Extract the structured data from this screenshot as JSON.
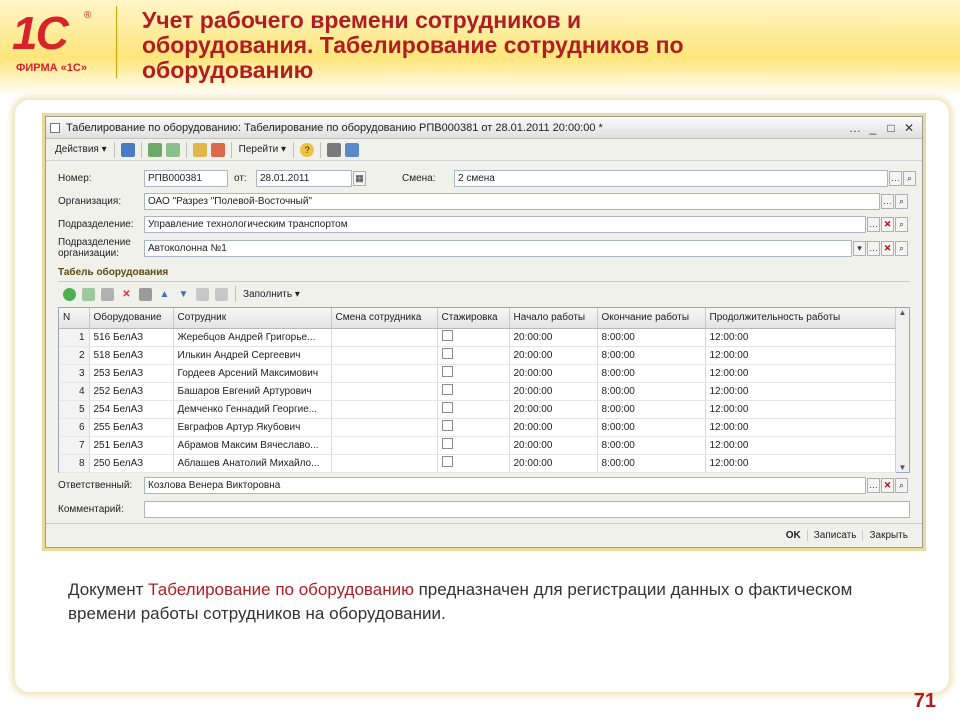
{
  "slide": {
    "logo_text": "1С",
    "logo_reg": "®",
    "logo_firm": "ФИРМА «1С»",
    "title": "Учет рабочего времени сотрудников и оборудования. Табелирование сотрудников по оборудованию",
    "desc_prefix": "Документ ",
    "desc_highlight": "Табелирование по оборудованию",
    "desc_suffix": " предназначен для регистрации данных о фактическом времени работы сотрудников на оборудовании.",
    "page_number": "71",
    "accent_color": "#b01e23"
  },
  "window": {
    "title": "Табелирование по оборудованию: Табелирование по оборудованию РПВ000381 от 28.01.2011 20:00:00 *",
    "controls": [
      "…",
      "_",
      "□",
      "✕"
    ],
    "toolbar": {
      "actions": "Действия",
      "goto": "Перейти",
      "help": "?"
    },
    "form": {
      "number_label": "Номер:",
      "number_value": "РПВ000381",
      "date_label": "от:",
      "date_value": "28.01.2011",
      "shift_label": "Смена:",
      "shift_value": "2 смена",
      "org_label": "Организация:",
      "org_value": "ОАО \"Разрез \"Полевой-Восточный\"",
      "dept_label": "Подразделение:",
      "dept_value": "Управление технологическим транспортом",
      "orgdept_label_1": "Подразделение",
      "orgdept_label_2": "организации:",
      "orgdept_value": "Автоколонна №1",
      "responsible_label": "Ответственный:",
      "responsible_value": "Козлова Венера Викторовна",
      "comment_label": "Комментарий:",
      "comment_value": ""
    },
    "table_section": "Табель оборудования",
    "table_toolbar_fill": "Заполнить",
    "columns": [
      "N",
      "Оборудование",
      "Сотрудник",
      "Смена сотрудника",
      "Стажировка",
      "Начало работы",
      "Окончание работы",
      "Продолжительность работы"
    ],
    "rows": [
      {
        "n": "1",
        "equipment": "516 БелАЗ",
        "employee": "Жеребцов Андрей Григорье...",
        "shift": "",
        "start": "20:00:00",
        "end": "8:00:00",
        "duration": "12:00:00"
      },
      {
        "n": "2",
        "equipment": "518 БелАЗ",
        "employee": "Илькин Андрей Сергеевич",
        "shift": "",
        "start": "20:00:00",
        "end": "8:00:00",
        "duration": "12:00:00"
      },
      {
        "n": "3",
        "equipment": "253 БелАЗ",
        "employee": "Гордеев Арсений Максимович",
        "shift": "",
        "start": "20:00:00",
        "end": "8:00:00",
        "duration": "12:00:00"
      },
      {
        "n": "4",
        "equipment": "252 БелАЗ",
        "employee": "Башаров Евгений Артурович",
        "shift": "",
        "start": "20:00:00",
        "end": "8:00:00",
        "duration": "12:00:00"
      },
      {
        "n": "5",
        "equipment": "254 БелАЗ",
        "employee": "Демченко Геннадий Георгие...",
        "shift": "",
        "start": "20:00:00",
        "end": "8:00:00",
        "duration": "12:00:00"
      },
      {
        "n": "6",
        "equipment": "255 БелАЗ",
        "employee": "Евграфов Артур Якубович",
        "shift": "",
        "start": "20:00:00",
        "end": "8:00:00",
        "duration": "12:00:00"
      },
      {
        "n": "7",
        "equipment": "251 БелАЗ",
        "employee": "Абрамов Максим Вячеславо...",
        "shift": "",
        "start": "20:00:00",
        "end": "8:00:00",
        "duration": "12:00:00"
      },
      {
        "n": "8",
        "equipment": "250 БелАЗ",
        "employee": "Аблашев Анатолий Михайло...",
        "shift": "",
        "start": "20:00:00",
        "end": "8:00:00",
        "duration": "12:00:00"
      }
    ],
    "buttons": {
      "ok": "OK",
      "save": "Записать",
      "close": "Закрыть"
    }
  }
}
